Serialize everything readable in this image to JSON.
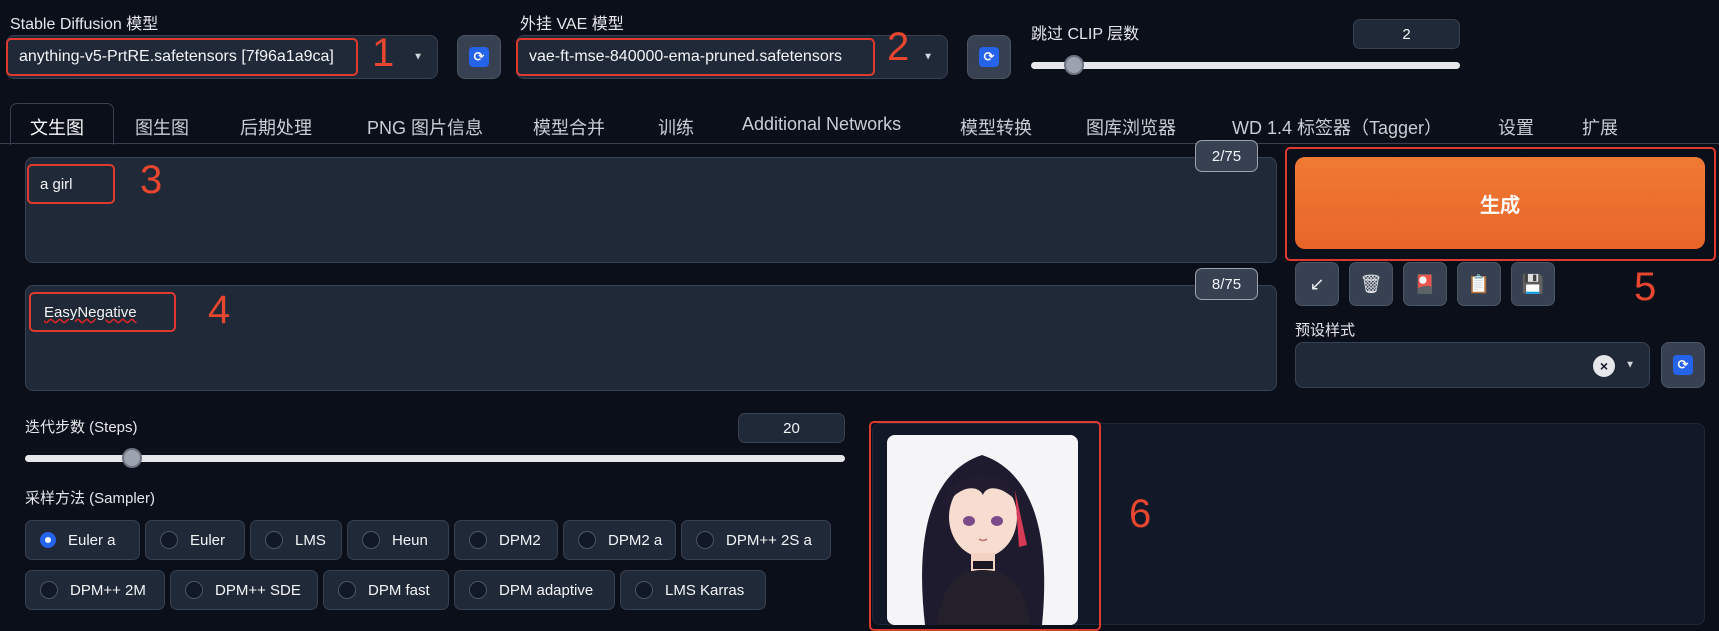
{
  "header": {
    "sd_model_label": "Stable Diffusion 模型",
    "sd_model_value": "anything-v5-PrtRE.safetensors [7f96a1a9ca]",
    "vae_label": "外挂 VAE 模型",
    "vae_value": "vae-ft-mse-840000-ema-pruned.safetensors",
    "clip_label": "跳过 CLIP 层数",
    "clip_value": "2",
    "clip_fraction": 0.1
  },
  "tabs": [
    "文生图",
    "图生图",
    "后期处理",
    "PNG 图片信息",
    "模型合并",
    "训练",
    "Additional Networks",
    "模型转换",
    "图库浏览器",
    "WD 1.4 标签器（Tagger）",
    "设置",
    "扩展"
  ],
  "prompt": {
    "value": "a girl",
    "counter": "2/75"
  },
  "negative_prompt": {
    "value": "EasyNegative",
    "counter": "8/75"
  },
  "generate_label": "生成",
  "tools": {
    "arrow": "↙",
    "trash": "🗑",
    "style": "🎴",
    "clipboard": "📋",
    "save": "💾"
  },
  "styles": {
    "label": "预设样式",
    "clear": "×"
  },
  "steps": {
    "label": "迭代步数 (Steps)",
    "value": "20",
    "fraction": 0.13
  },
  "sampler": {
    "label": "采样方法 (Sampler)",
    "selected": "Euler a",
    "row1": [
      "Euler a",
      "Euler",
      "LMS",
      "Heun",
      "DPM2",
      "DPM2 a",
      "DPM++ 2S a"
    ],
    "row2": [
      "DPM++ 2M",
      "DPM++ SDE",
      "DPM fast",
      "DPM adaptive",
      "LMS Karras"
    ]
  },
  "annotations": [
    "1",
    "2",
    "3",
    "4",
    "5",
    "6"
  ],
  "colors": {
    "accent": "#2563eb",
    "generate": "#ea6a25",
    "highlight": "#e03a2f",
    "background": "#0b0f19"
  }
}
